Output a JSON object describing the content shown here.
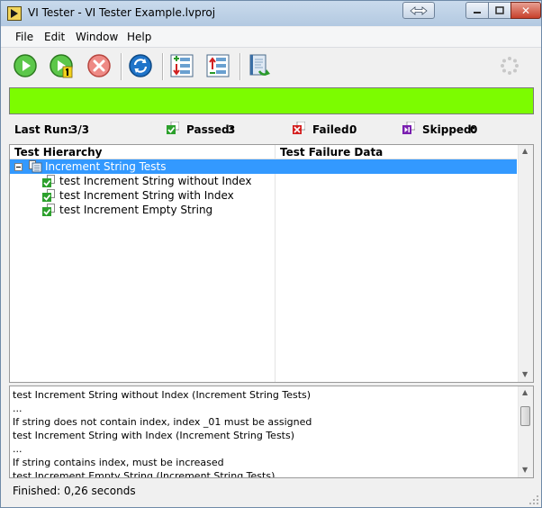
{
  "window": {
    "title": "VI Tester - VI Tester Example.lvproj"
  },
  "menu": [
    "File",
    "Edit",
    "Window",
    "Help"
  ],
  "toolbar": {
    "icons": [
      "run-icon",
      "run-single-icon",
      "stop-icon",
      "refresh-icon",
      "expand-all-icon",
      "collapse-all-icon",
      "report-icon",
      "busy-spinner-icon"
    ]
  },
  "status_color": "#7cfc00",
  "summary": {
    "last_run_label": "Last Run:",
    "last_run_value": "3/3",
    "passed_label": "Passed:",
    "passed_value": "3",
    "failed_label": "Failed:",
    "failed_value": "0",
    "skipped_label": "Skipped:",
    "skipped_value": "0"
  },
  "tree": {
    "col_hierarchy": "Test Hierarchy",
    "col_failure": "Test Failure Data",
    "expander": "−",
    "root": "Increment String Tests",
    "children": [
      "test Increment String without Index",
      "test Increment String with Index",
      "test Increment Empty String"
    ]
  },
  "log": [
    "test Increment String without Index (Increment String Tests)",
    "...",
    "If string does not contain index, index _01 must be assigned",
    "test Increment String with Index (Increment String Tests)",
    "...",
    "If string contains index, must be increased",
    "test Increment Empty String (Increment String Tests)"
  ],
  "status": "Finished: 0,26 seconds"
}
